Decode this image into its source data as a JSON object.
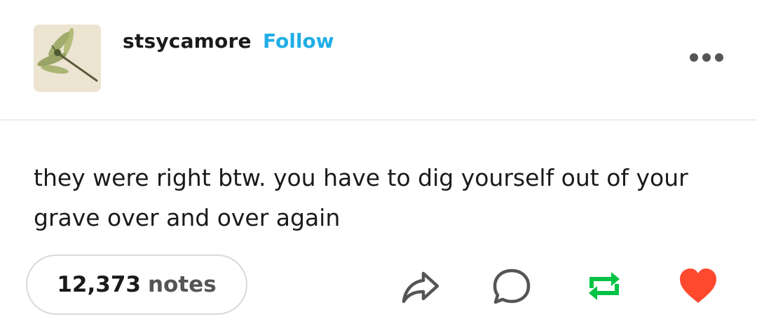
{
  "post": {
    "username": "stsycamore",
    "follow_label": "Follow",
    "text": "they were right btw. you have to dig yourself out of your grave over and over again",
    "notes_count": "12,373",
    "notes_label": "notes"
  },
  "icons": {
    "avatar": "dragonfly-icon",
    "more": "more-dots-icon",
    "share": "share-icon",
    "reply": "reply-icon",
    "reblog": "reblog-icon",
    "like": "heart-icon"
  },
  "colors": {
    "follow": "#1eaee6",
    "reblog": "#00c244",
    "like": "#ff492f",
    "avatar_bg": "#ece4d1"
  }
}
